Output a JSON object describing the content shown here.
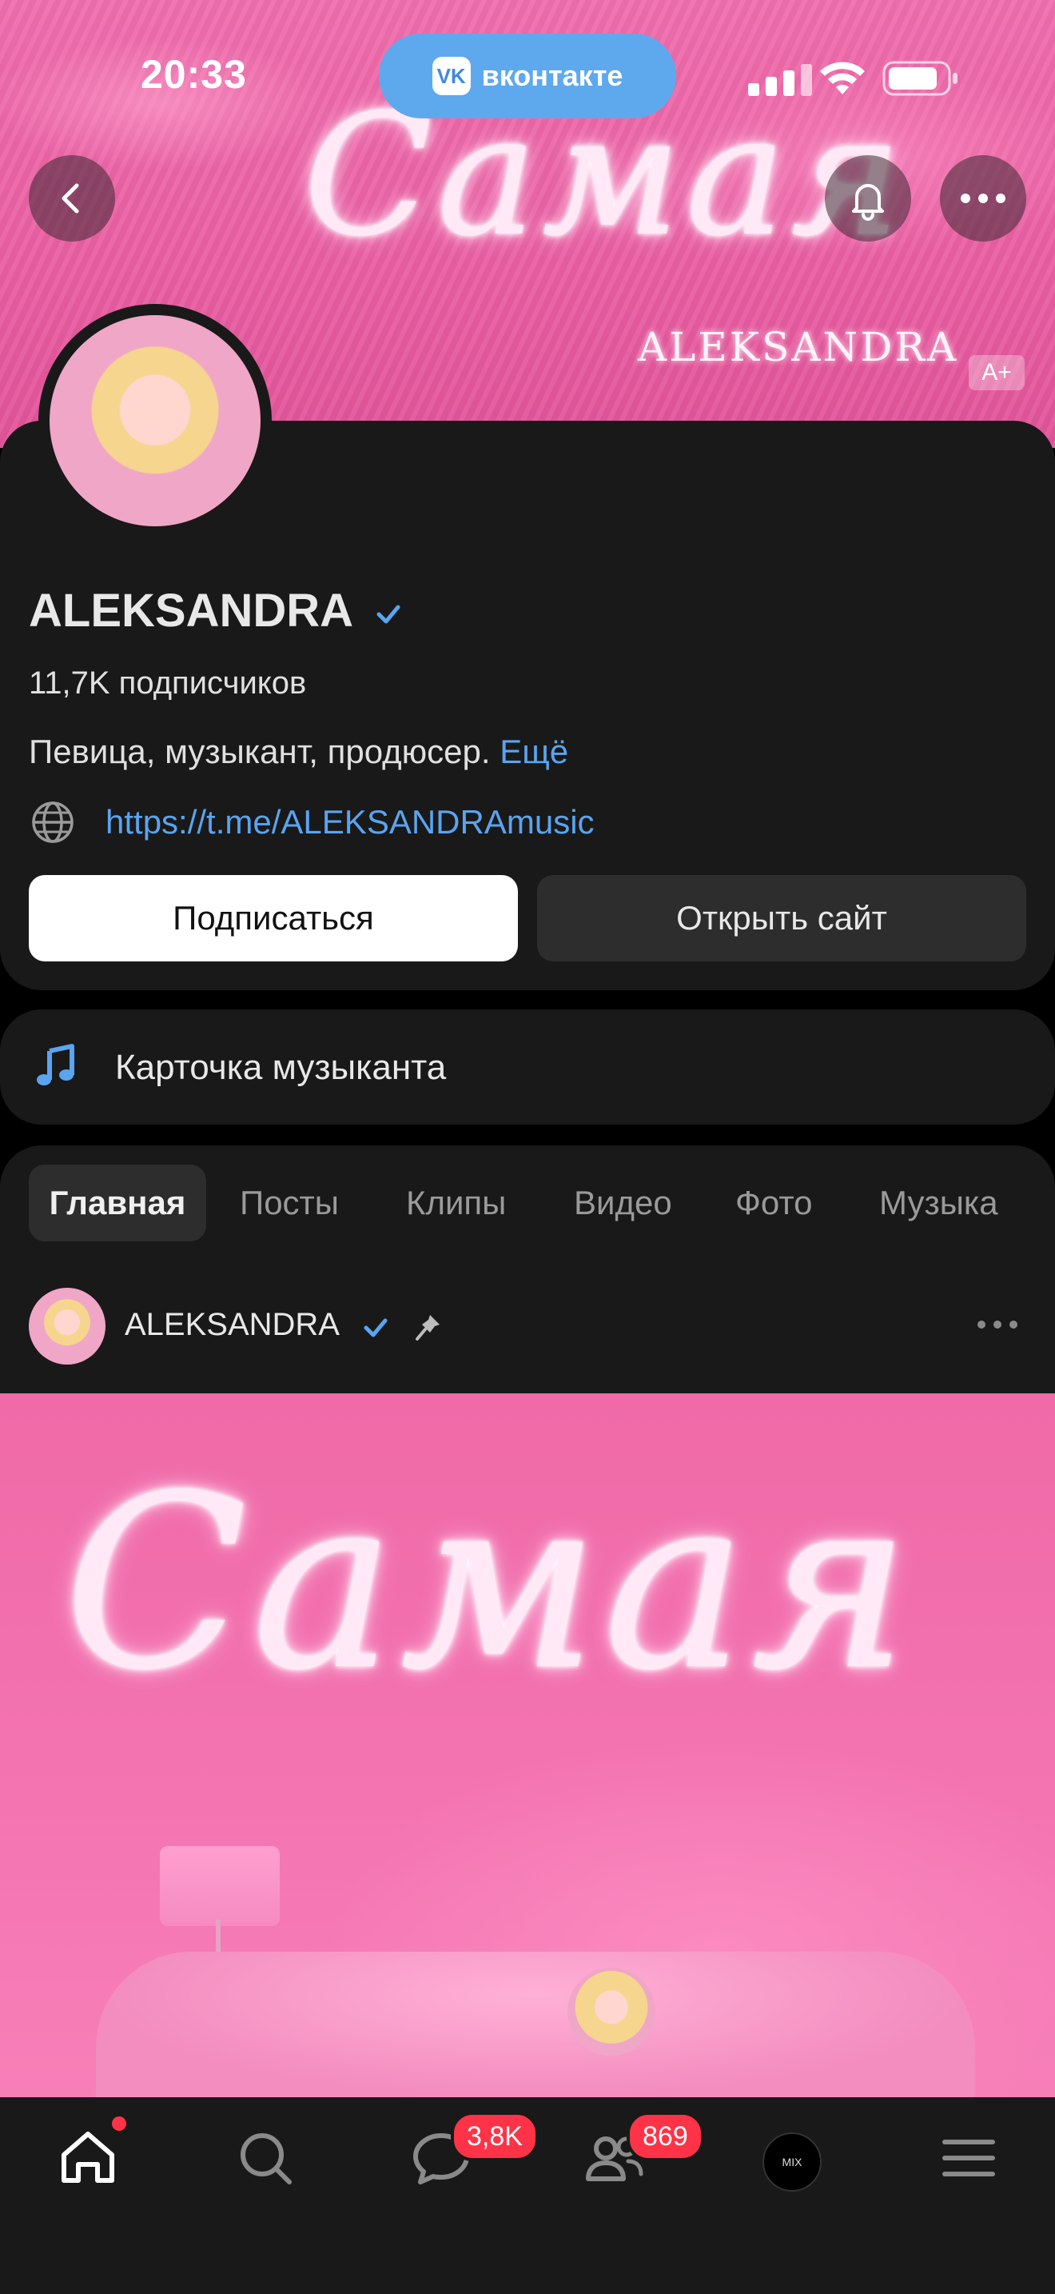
{
  "status_bar": {
    "time": "20:33",
    "app_pill_label": "вконтакте",
    "app_pill_logo": "VK"
  },
  "cover": {
    "title": "Самая",
    "subtitle": "ALEKSANDRA",
    "age_rating": "A+"
  },
  "profile": {
    "name": "ALEKSANDRA",
    "subscribers": "11,7K подписчиков",
    "bio": "Певица, музыкант, продюсер.",
    "bio_more": "Ещё",
    "link": "https://t.me/ALEKSANDRAmusic",
    "subscribe_label": "Подписаться",
    "open_site_label": "Открыть сайт"
  },
  "musician_card": {
    "label": "Карточка музыканта"
  },
  "tabs": [
    {
      "label": "Главная",
      "active": true
    },
    {
      "label": "Посты"
    },
    {
      "label": "Клипы"
    },
    {
      "label": "Видео"
    },
    {
      "label": "Фото"
    },
    {
      "label": "Музыка"
    }
  ],
  "post": {
    "author": "ALEKSANDRA",
    "image_title": "Самая"
  },
  "bottom_nav": {
    "messages_badge": "3,8K",
    "friends_badge": "869",
    "vkmix_label": "MIX"
  },
  "colors": {
    "accent": "#5aa4f0",
    "badge": "#ff3347",
    "cover_pink": "#f06fae",
    "card_bg": "#191919"
  }
}
